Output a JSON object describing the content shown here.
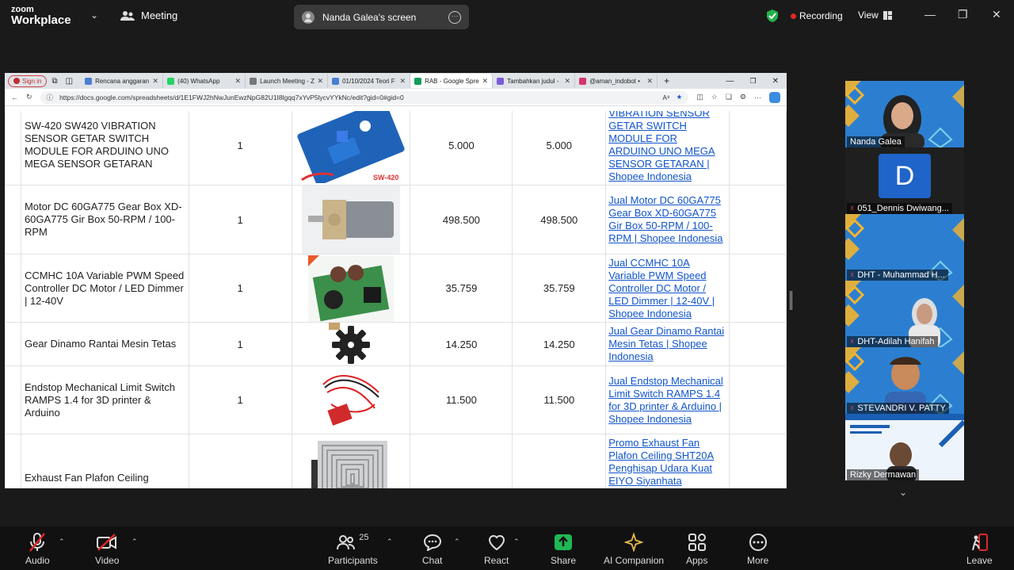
{
  "topbar": {
    "logo_line1": "zoom",
    "logo_line2": "Workplace",
    "meeting_label": "Meeting",
    "viewing_label": "Nanda Galea's screen",
    "recording_label": "Recording",
    "view_label": "View"
  },
  "browser": {
    "signin_label": "Sign in",
    "tabs": [
      {
        "title": "Rencana anggaran",
        "color": "#4a7fd0"
      },
      {
        "title": "(40) WhatsApp",
        "color": "#25d366"
      },
      {
        "title": "Launch Meeting - Z",
        "color": "#777777"
      },
      {
        "title": "01/10/2024 Teori F",
        "color": "#4a7fd0"
      },
      {
        "title": "RAB - Google Spre",
        "color": "#0f9d58"
      },
      {
        "title": "Tambahkan judul -",
        "color": "#7b5cd6"
      },
      {
        "title": "@aman_indobot •",
        "color": "#d6336c"
      }
    ],
    "url": "https://docs.google.com/spreadsheets/d/1E1FWJ2hNwJunEwzNpG82U1I8lgqq7xYvP5lycvYYkNc/edit?gid=0#gid=0"
  },
  "sheet": {
    "rows": [
      {
        "name": "SW-420 SW420 VIBRATION SENSOR GETAR SWITCH MODULE FOR ARDUINO UNO MEGA SENSOR GETARAN",
        "qty": "1",
        "price": "5.000",
        "total": "5.000",
        "link": "VIBRATION SENSOR GETAR SWITCH MODULE FOR ARDUINO UNO MEGA SENSOR GETARAN | Shopee Indonesia",
        "thumb": "sensor"
      },
      {
        "name": "Motor DC 60GA775 Gear Box XD-60GA775 Gir Box 50-RPM / 100-RPM",
        "qty": "1",
        "price": "498.500",
        "total": "498.500",
        "link": "Jual Motor DC 60GA775 Gear Box XD-60GA775 Gir Box 50-RPM / 100-RPM | Shopee Indonesia",
        "thumb": "motor"
      },
      {
        "name": "CCMHC 10A Variable PWM Speed Controller DC Motor / LED Dimmer | 12-40V",
        "qty": "1",
        "price": "35.759",
        "total": "35.759",
        "link": "Jual CCMHC 10A Variable PWM Speed Controller DC Motor / LED Dimmer | 12-40V | Shopee Indonesia",
        "thumb": "pwm"
      },
      {
        "name": "Gear Dinamo Rantai Mesin Tetas",
        "qty": "1",
        "price": "14.250",
        "total": "14.250",
        "link": "Jual Gear Dinamo Rantai Mesin Tetas | Shopee Indonesia",
        "thumb": "gear"
      },
      {
        "name": "Endstop Mechanical Limit Switch RAMPS 1.4 for 3D printer & Arduino",
        "qty": "1",
        "price": "11.500",
        "total": "11.500",
        "link": "Jual Endstop Mechanical Limit Switch RAMPS 1.4 for 3D printer & Arduino | Shopee Indonesia",
        "thumb": "endstop"
      },
      {
        "name": "Exhaust Fan Plafon Ceiling",
        "qty": "",
        "price": "",
        "total": "",
        "link": "Promo Exhaust Fan Plafon Ceiling SHT20A Penghisap Udara Kuat EIYO Siyanhata",
        "thumb": "fan"
      }
    ],
    "sensor_label": "SW-420"
  },
  "participants": [
    {
      "name": "Nanda Galea",
      "muted": false,
      "kind": "video-girl"
    },
    {
      "name": "051_Dennis Dwiwang...",
      "muted": true,
      "kind": "avatar",
      "initial": "D"
    },
    {
      "name": "DHT - Muhammad H...",
      "muted": true,
      "kind": "pattern"
    },
    {
      "name": "DHT-Adilah Hanifah",
      "muted": true,
      "kind": "video-girl2"
    },
    {
      "name": "STEVANDRI V. PATTY",
      "muted": true,
      "kind": "memoji"
    },
    {
      "name": "Rizky Dermawan",
      "muted": false,
      "kind": "slide"
    }
  ],
  "toolbar": {
    "audio": "Audio",
    "video": "Video",
    "participants": "Participants",
    "participants_count": "25",
    "chat": "Chat",
    "react": "React",
    "share": "Share",
    "ai": "AI Companion",
    "apps": "Apps",
    "more": "More",
    "leave": "Leave"
  }
}
